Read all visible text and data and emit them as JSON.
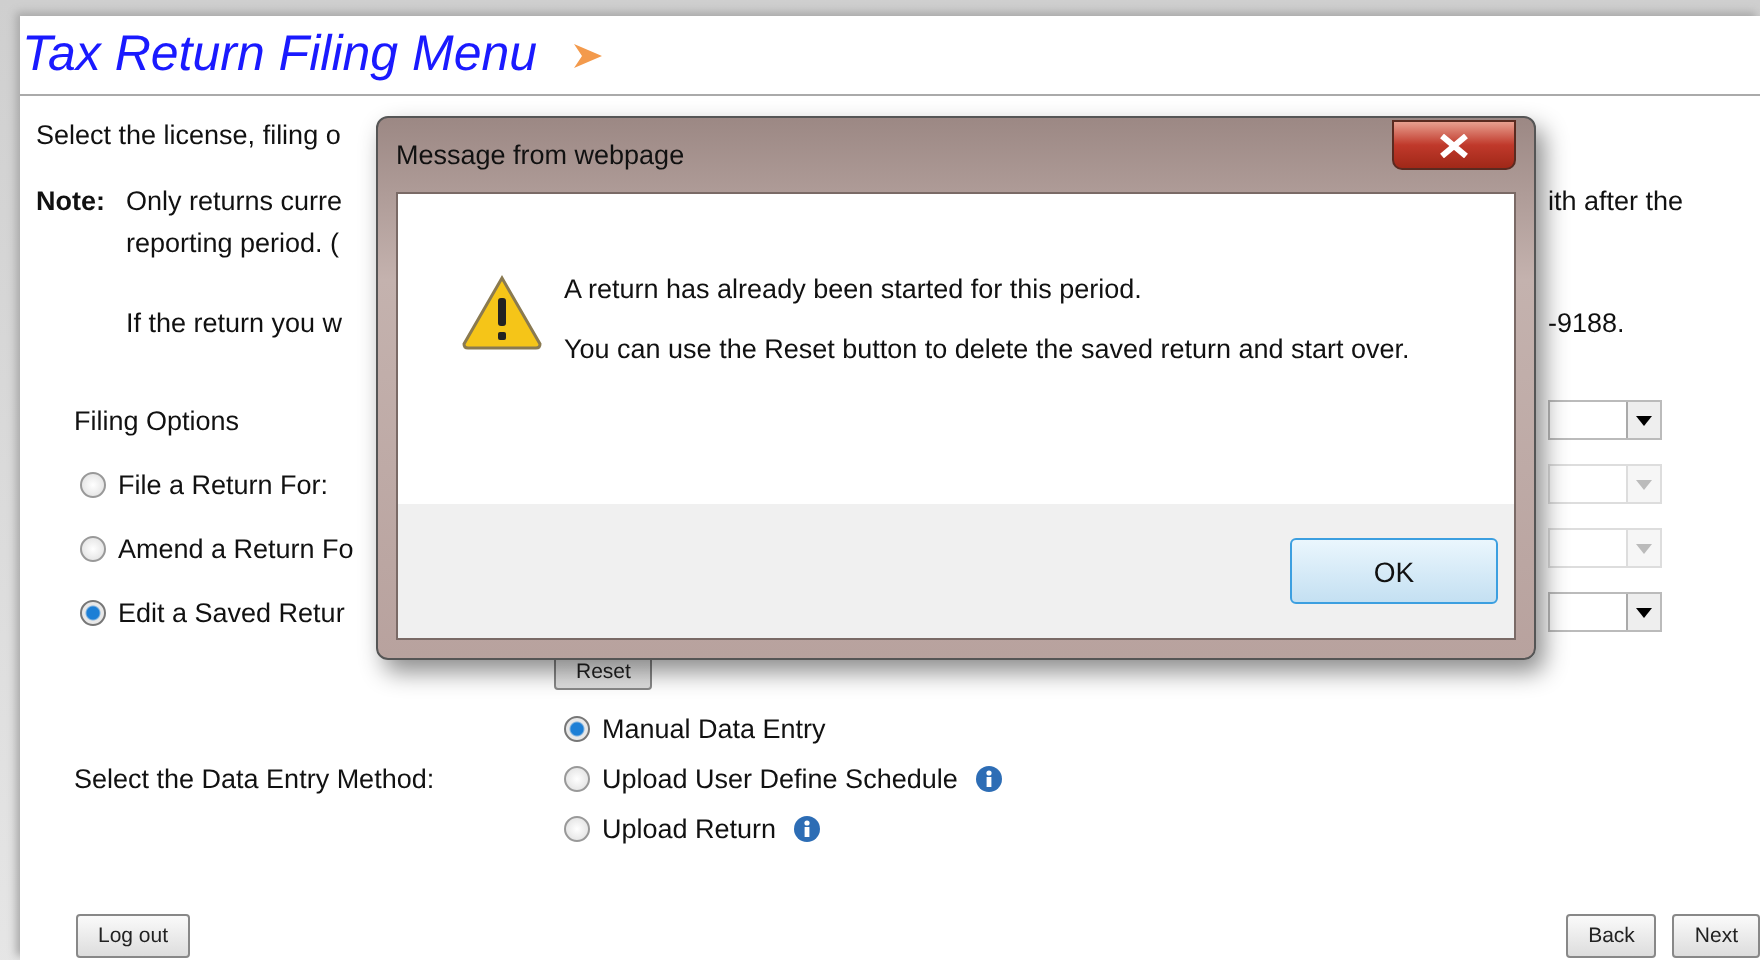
{
  "page": {
    "title": "Tax Return Filing Menu",
    "intro": "Select the license, filing o",
    "note": {
      "label": "Note:",
      "lines": [
        "Only returns curre",
        "reporting period. (",
        "If the return you w"
      ],
      "right_lines": [
        "ith after the",
        "-9188."
      ]
    },
    "filing_options": {
      "label": "Filing Options",
      "heading_dropdown": {
        "disabled": false
      },
      "options": [
        {
          "label": "File a Return For:",
          "selected": false,
          "dropdown": {
            "disabled": true
          }
        },
        {
          "label": "Amend a Return Fo",
          "selected": false,
          "dropdown": {
            "disabled": true
          }
        },
        {
          "label": "Edit a Saved Retur",
          "selected": true,
          "dropdown": {
            "disabled": false
          }
        }
      ],
      "reset_button": "Reset"
    },
    "data_entry": {
      "label": "Select the Data Entry Method:",
      "options": [
        {
          "label": "Manual Data Entry",
          "selected": true,
          "info": false
        },
        {
          "label": "Upload User Define Schedule",
          "selected": false,
          "info": true
        },
        {
          "label": "Upload Return",
          "selected": false,
          "info": true
        }
      ]
    },
    "buttons": {
      "logout": "Log out",
      "back": "Back",
      "next": "Next"
    }
  },
  "dialog": {
    "title": "Message from webpage",
    "messages": [
      "A return has already been started for this period.",
      "You can use the Reset button to delete the saved return and start over."
    ],
    "ok_button": "OK"
  }
}
